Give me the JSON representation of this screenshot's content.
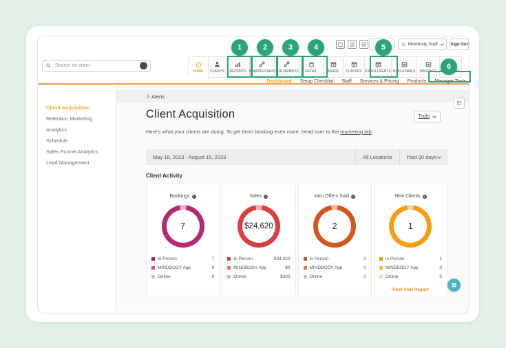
{
  "annotations": {
    "color": "#2aa47b",
    "steps": [
      "1",
      "2",
      "3",
      "4",
      "5",
      "6"
    ]
  },
  "header": {
    "search_placeholder": "Search for client",
    "staff_label": "Mindbody Staff",
    "sign_out_label": "Sign Out",
    "tabs": [
      {
        "label": "HOME",
        "active": true
      },
      {
        "label": "CLIENTS"
      },
      {
        "label": "REPORTS"
      },
      {
        "label": "BRANDED WEB"
      },
      {
        "label": "OUR WEBSITE"
      },
      {
        "label": "RETAIL"
      },
      {
        "label": "BARRE"
      },
      {
        "label": "CLASSES"
      },
      {
        "label": "ENROLLMENTS"
      },
      {
        "label": "HAIR & NAILS"
      },
      {
        "label": "MASSAGE"
      },
      {
        "label": "MARKETING"
      }
    ],
    "subnav": [
      {
        "label": "Dashboard",
        "active": true
      },
      {
        "label": "Setup Checklist"
      },
      {
        "label": "Staff"
      },
      {
        "label": "Services & Pricing"
      },
      {
        "label": "Products"
      },
      {
        "label": "Manager Tools"
      }
    ]
  },
  "sidebar": {
    "items": [
      {
        "label": "Client Acquisition",
        "active": true
      },
      {
        "label": "Retention Marketing"
      },
      {
        "label": "Analytics"
      },
      {
        "label": "Schedule"
      },
      {
        "label": "Sales Funnel Analytics"
      },
      {
        "label": "Lead Management"
      }
    ]
  },
  "main": {
    "breadcrumb": "Alerts",
    "title": "Client Acquisition",
    "description_prefix": "Here's what your clients are doing. To get them booking even more, head over to the ",
    "description_link": "marketing tab",
    "description_suffix": ".",
    "tools_label": "Tools",
    "date_range": "May 18, 2023 - August 15, 2023",
    "location_filter": "All Locations",
    "period_filter": "Past 90 days",
    "section_title": "Client Activity"
  },
  "cards": [
    {
      "title": "Bookings",
      "total": "7",
      "ring_main": "#b42a6f",
      "ring_light": "#efb3d0",
      "legend": [
        {
          "label": "In Person",
          "value": "7",
          "color": "#a81f63"
        },
        {
          "label": "MINDBODY App",
          "value": "0",
          "color": "#c75b9b"
        },
        {
          "label": "Online",
          "value": "0",
          "color": "#eeb0cf"
        }
      ]
    },
    {
      "title": "Sales",
      "total": "$24,620",
      "ring_main": "#d84040",
      "ring_light": "#f3b1b1",
      "legend": [
        {
          "label": "In Person",
          "value": "$24,320",
          "color": "#d53a3a"
        },
        {
          "label": "MINDBODY App",
          "value": "$0",
          "color": "#e47575"
        },
        {
          "label": "Online",
          "value": "$300",
          "color": "#f3adad"
        }
      ]
    },
    {
      "title": "Intro Offers Sold",
      "total": "2",
      "ring_main": "#d4561f",
      "ring_light": "#f0bda4",
      "legend": [
        {
          "label": "In Person",
          "value": "2",
          "color": "#d14f1c"
        },
        {
          "label": "MINDBODY App",
          "value": "0",
          "color": "#e28150"
        },
        {
          "label": "Online",
          "value": "0",
          "color": "#f0b99c"
        }
      ]
    },
    {
      "title": "New Clients",
      "total": "1",
      "ring_main": "#f79c15",
      "ring_light": "#fbd9a3",
      "footer_link": "First Visit Report",
      "legend": [
        {
          "label": "In Person",
          "value": "1",
          "color": "#f6990e"
        },
        {
          "label": "MINDBODY App",
          "value": "0",
          "color": "#f9b554"
        },
        {
          "label": "Online",
          "value": "0",
          "color": "#fcd8a2"
        }
      ]
    }
  ],
  "chart_data": [
    {
      "type": "pie",
      "title": "Bookings",
      "total": 7,
      "categories": [
        "In Person",
        "MINDBODY App",
        "Online"
      ],
      "values": [
        7,
        0,
        0
      ]
    },
    {
      "type": "pie",
      "title": "Sales",
      "total": 24620,
      "categories": [
        "In Person",
        "MINDBODY App",
        "Online"
      ],
      "values": [
        24320,
        0,
        300
      ]
    },
    {
      "type": "pie",
      "title": "Intro Offers Sold",
      "total": 2,
      "categories": [
        "In Person",
        "MINDBODY App",
        "Online"
      ],
      "values": [
        2,
        0,
        0
      ]
    },
    {
      "type": "pie",
      "title": "New Clients",
      "total": 1,
      "categories": [
        "In Person",
        "MINDBODY App",
        "Online"
      ],
      "values": [
        1,
        0,
        0
      ]
    }
  ],
  "colors": {
    "accent_orange": "#f6a21e",
    "annotation_green": "#2aa47b",
    "floating_button_teal": "#4cb2c2"
  }
}
